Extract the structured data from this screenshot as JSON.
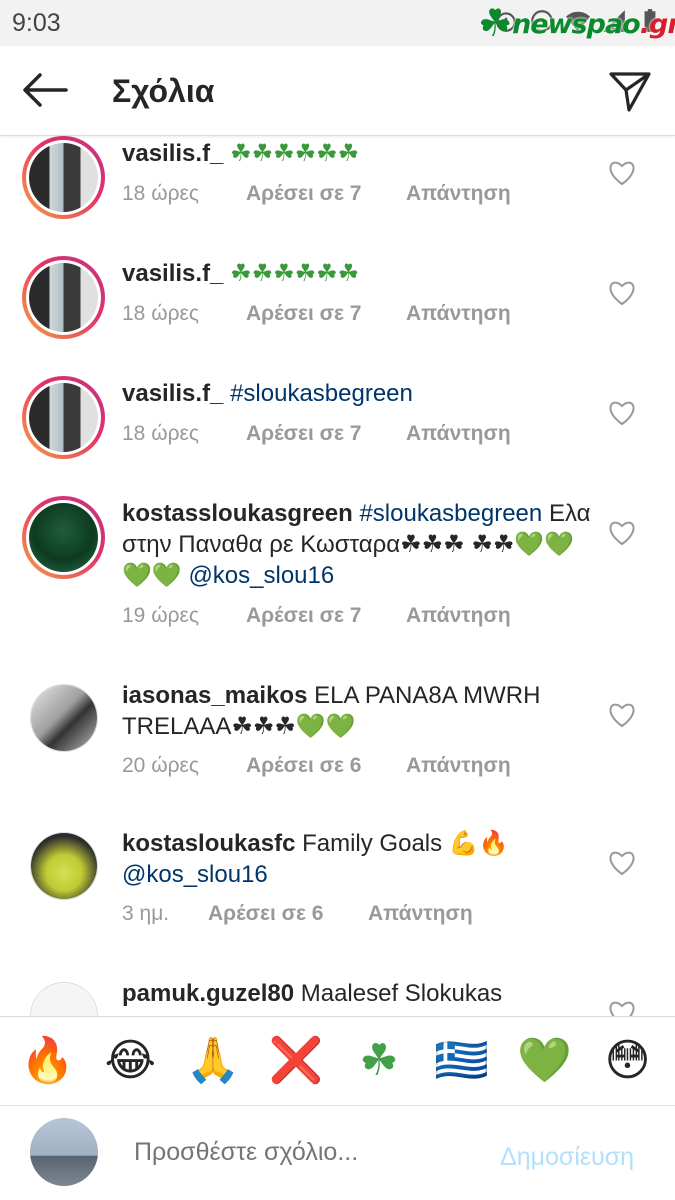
{
  "status": {
    "time": "9:03"
  },
  "watermark": {
    "brand": "newspao",
    "suffix": ".gr"
  },
  "header": {
    "title": "Σχόλια"
  },
  "comments": [
    {
      "user": "vasilis.f_",
      "text": "☘☘☘☘☘☘",
      "tag": "",
      "time": "18 ώρες",
      "likes": "Αρέσει σε 7",
      "reply": "Απάντηση"
    },
    {
      "user": "vasilis.f_",
      "text": "☘☘☘☘☘☘",
      "tag": "",
      "time": "18 ώρες",
      "likes": "Αρέσει σε 7",
      "reply": "Απάντηση"
    },
    {
      "user": "vasilis.f_",
      "text": "",
      "tag": "#sloukasbegreen",
      "time": "18 ώρες",
      "likes": "Αρέσει σε 7",
      "reply": "Απάντηση"
    },
    {
      "user": "kostassloukasgreen",
      "tag": "#sloukasbegreen",
      "text": "Ελα στην Παναθα ρε Κωσταρα☘☘☘ ☘☘💚💚💚💚",
      "mention": "@kos_slou16",
      "time": "19 ώρες",
      "likes": "Αρέσει σε 7",
      "reply": "Απάντηση"
    },
    {
      "user": "iasonas_maikos",
      "text": "ELA PANA8A MWRH TRELAAA☘☘☘💚💚",
      "time": "20 ώρες",
      "likes": "Αρέσει σε 6",
      "reply": "Απάντηση"
    },
    {
      "user": "kostaslоukasfc",
      "text": "Family Goals 💪🔥",
      "mention": "@kos_slou16",
      "time": "3 ημ.",
      "likes": "Αρέσει σε 6",
      "reply": "Απάντηση"
    },
    {
      "user": "pamuk.guzel80",
      "text": "Maalesef Slokukas",
      "time": "",
      "likes": "",
      "reply": ""
    }
  ],
  "emoji_bar": [
    "🔥",
    "😂",
    "🙏",
    "❌",
    "☘",
    "🇬🇷",
    "💚",
    "😳"
  ],
  "composer": {
    "placeholder": "Προσθέστε σχόλιο...",
    "post_label": "Δημοσίευση"
  },
  "colors": {
    "link": "#003569",
    "meta": "#999999",
    "post_disabled": "#b2dffc",
    "brand_green": "#0a8a2a"
  }
}
